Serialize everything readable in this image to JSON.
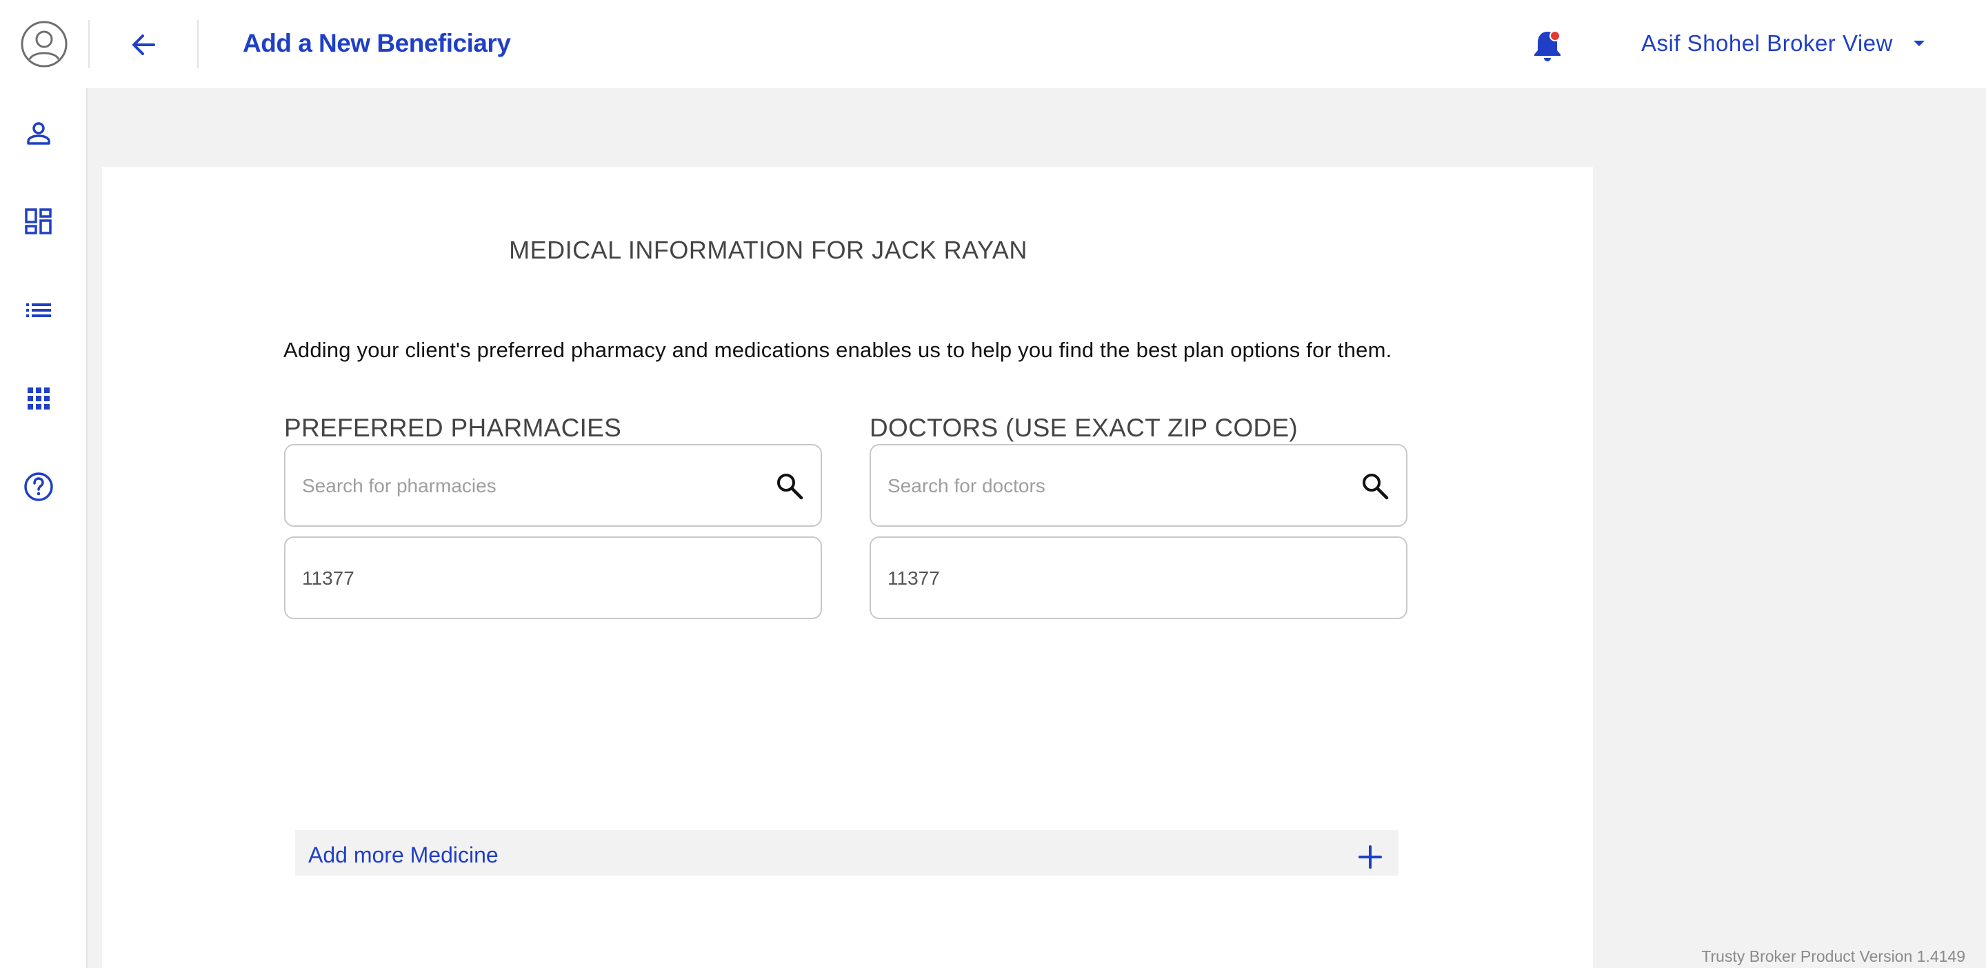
{
  "header": {
    "title": "Add a New Beneficiary",
    "user_menu_label": "Asif Shohel Broker View",
    "icons": {
      "avatar": "user-circle-icon",
      "back": "arrow-left-icon",
      "notifications": "bell-icon",
      "menu_caret": "caret-down-icon"
    }
  },
  "sidebar": {
    "items": [
      {
        "icon": "person-icon"
      },
      {
        "icon": "dashboard-icon"
      },
      {
        "icon": "list-icon"
      },
      {
        "icon": "apps-grid-icon"
      },
      {
        "icon": "help-icon"
      }
    ]
  },
  "main": {
    "heading": "MEDICAL INFORMATION FOR JACK  RAYAN",
    "intro": "Adding your client's preferred pharmacy and medications enables us to help you find the best plan options for them.",
    "pharmacies": {
      "label": "PREFERRED PHARMACIES",
      "search_placeholder": "Search for pharmacies",
      "zip_value": "11377"
    },
    "doctors": {
      "label": "DOCTORS (USE EXACT ZIP CODE)",
      "search_placeholder": "Search for doctors",
      "zip_value": "11377"
    },
    "add_medicine_label": "Add more Medicine"
  },
  "footer": {
    "version": "Trusty Broker Product Version 1.4149"
  },
  "colors": {
    "accent": "#1f3fc6",
    "notification_dot": "#e53935",
    "page_background": "#f2f2f2"
  }
}
